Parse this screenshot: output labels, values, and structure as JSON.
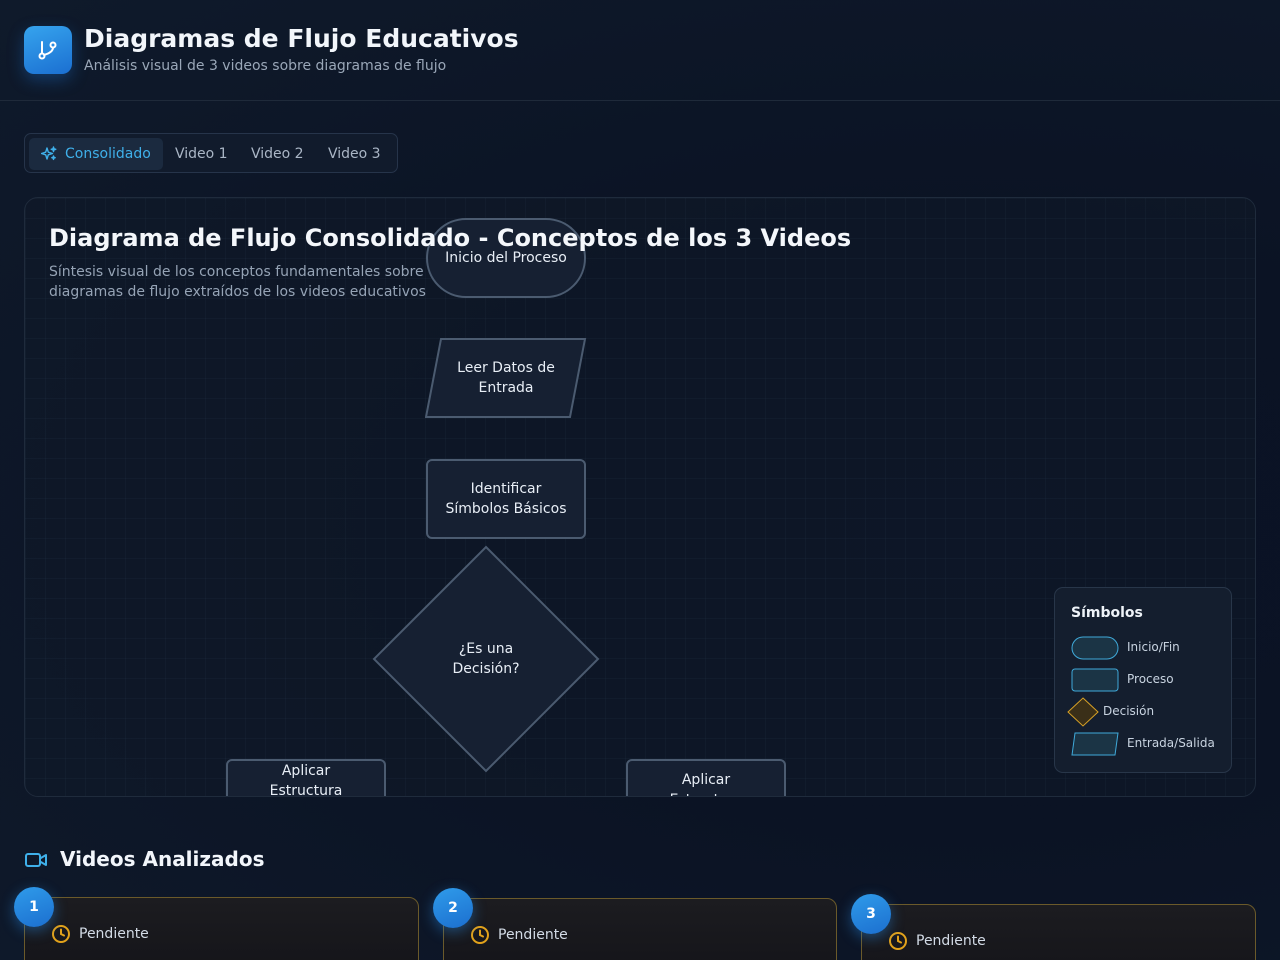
{
  "header": {
    "title": "Diagramas de Flujo Educativos",
    "subtitle": "Análisis visual de 3 videos sobre diagramas de flujo",
    "logo_icon": "git-branch-icon"
  },
  "tabs": [
    {
      "label": "Consolidado",
      "icon": "sparkles-icon",
      "active": true
    },
    {
      "label": "Video 1",
      "active": false
    },
    {
      "label": "Video 2",
      "active": false
    },
    {
      "label": "Video 3",
      "active": false
    }
  ],
  "diagram": {
    "title": "Diagrama de Flujo Consolidado - Conceptos de los 3 Videos",
    "description": "Síntesis visual de los conceptos fundamentales sobre diagramas de flujo extraídos de los videos educativos",
    "nodes": {
      "start": "Inicio del Proceso",
      "input": "Leer Datos de Entrada",
      "identify": "Identificar Símbolos Básicos",
      "decision": "¿Es una Decisión?",
      "left_branch": "Aplicar Estructura",
      "right_branch": "Aplicar Estructura"
    }
  },
  "legend": {
    "title": "Símbolos",
    "items": [
      {
        "label": "Inicio/Fin",
        "shape": "pill"
      },
      {
        "label": "Proceso",
        "shape": "rectangle"
      },
      {
        "label": "Decisión",
        "shape": "diamond"
      },
      {
        "label": "Entrada/Salida",
        "shape": "parallelogram"
      }
    ]
  },
  "videos_section": {
    "title": "Videos Analizados",
    "icon": "video-camera-icon",
    "cards": [
      {
        "number": "1",
        "status": "Pendiente",
        "status_icon": "clock-icon"
      },
      {
        "number": "2",
        "status": "Pendiente",
        "status_icon": "clock-icon"
      },
      {
        "number": "3",
        "status": "Pendiente",
        "status_icon": "clock-icon"
      }
    ]
  },
  "colors": {
    "accent": "#3fb0ea",
    "pending": "#e2a21b",
    "background": "#0b1324"
  }
}
